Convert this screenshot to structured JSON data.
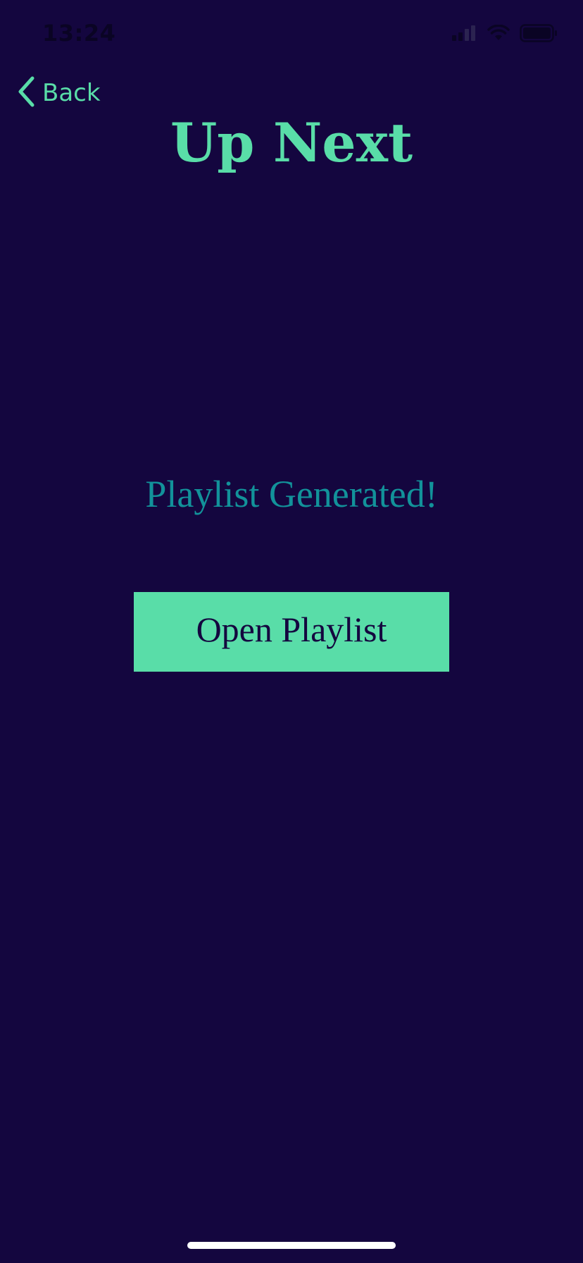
{
  "status_bar": {
    "time": "13:24",
    "icons": [
      "signal-icon",
      "wifi-icon",
      "battery-icon"
    ]
  },
  "nav": {
    "back_label": "Back",
    "back_icon": "chevron-left-icon"
  },
  "header": {
    "title": "Up Next"
  },
  "main": {
    "message": "Playlist Generated!",
    "open_button_label": "Open Playlist"
  },
  "colors": {
    "background": "#14063f",
    "accent": "#59dda8",
    "message": "#12929a",
    "button_text": "#14063f"
  }
}
